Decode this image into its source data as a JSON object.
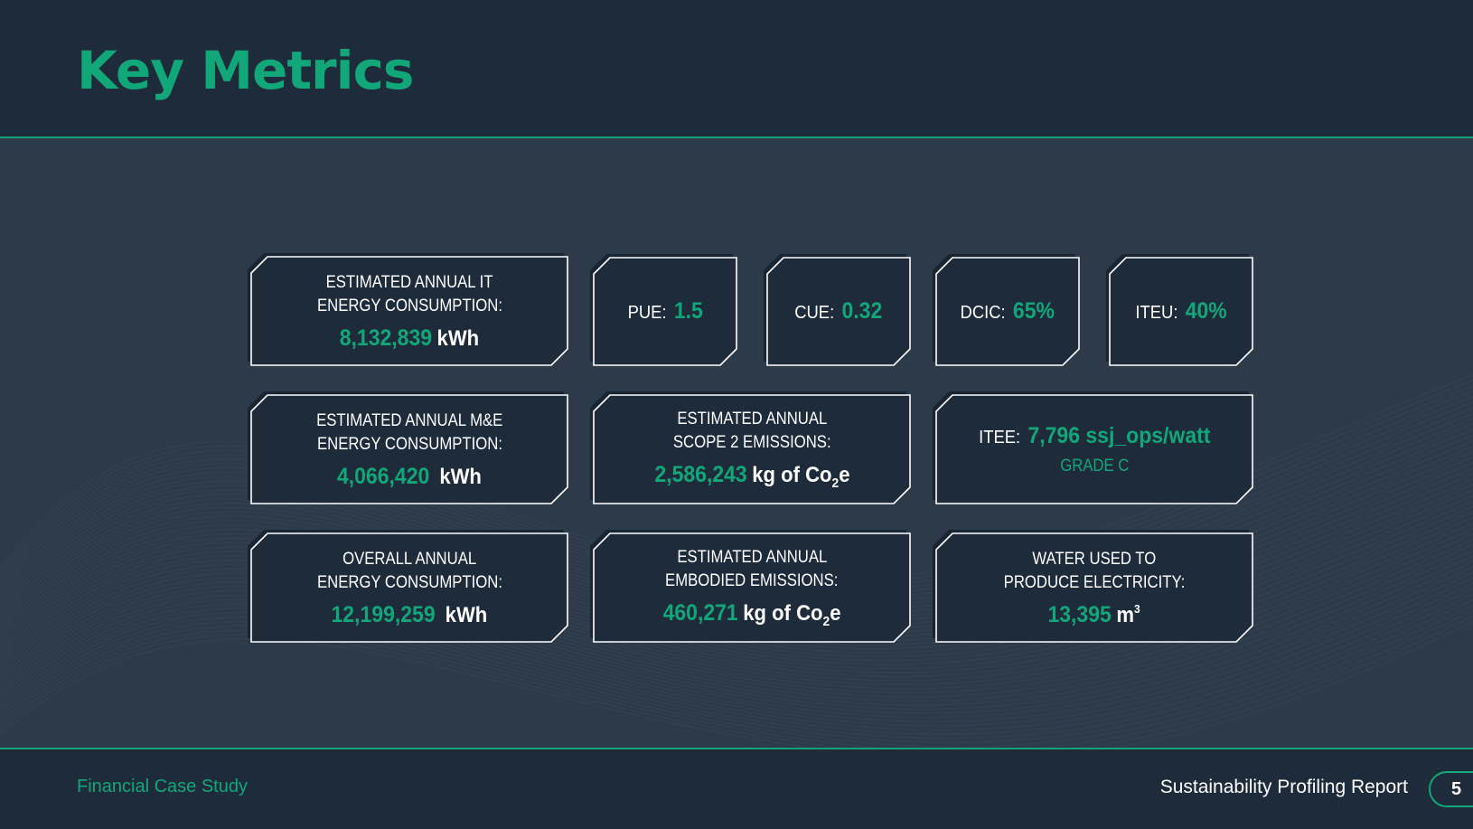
{
  "header": {
    "title": "Key Metrics"
  },
  "footer": {
    "left": "Financial Case Study",
    "right": "Sustainability Profiling Report",
    "page": "5"
  },
  "colors": {
    "accent": "#12a779",
    "card_bg": "#1e2b3b",
    "background": "#2d3a4a"
  },
  "metrics": {
    "it_energy": {
      "label1": "ESTIMATED ANNUAL IT",
      "label2": "ENERGY CONSUMPTION:",
      "value": "8,132,839",
      "unit": "kWh"
    },
    "pue": {
      "label": "PUE:",
      "value": "1.5"
    },
    "cue": {
      "label": "CUE:",
      "value": "0.32"
    },
    "dcic": {
      "label": "DCIC:",
      "value": "65%"
    },
    "iteu": {
      "label": "ITEU:",
      "value": "40%"
    },
    "me_energy": {
      "label1": "ESTIMATED ANNUAL M&E",
      "label2": "ENERGY CONSUMPTION:",
      "value": "4,066,420",
      "unit": "kWh"
    },
    "scope2": {
      "label1": "ESTIMATED ANNUAL",
      "label2": "SCOPE 2 EMISSIONS:",
      "value": "2,586,243",
      "unit_pre": "kg of Co",
      "unit_sub": "2",
      "unit_post": "e"
    },
    "itee": {
      "label": "ITEE:",
      "value": "7,796 ssj_ops/watt",
      "grade": "GRADE C"
    },
    "overall_energy": {
      "label1": "OVERALL ANNUAL",
      "label2": "ENERGY CONSUMPTION:",
      "value": "12,199,259",
      "unit": "kWh"
    },
    "embodied": {
      "label1": "ESTIMATED ANNUAL",
      "label2": "EMBODIED EMISSIONS:",
      "value": "460,271",
      "unit_pre": "kg of Co",
      "unit_sub": "2",
      "unit_post": "e"
    },
    "water": {
      "label1": "WATER USED TO",
      "label2": "PRODUCE ELECTRICITY:",
      "value": "13,395",
      "unit_pre": "m",
      "unit_sup": "3"
    }
  }
}
